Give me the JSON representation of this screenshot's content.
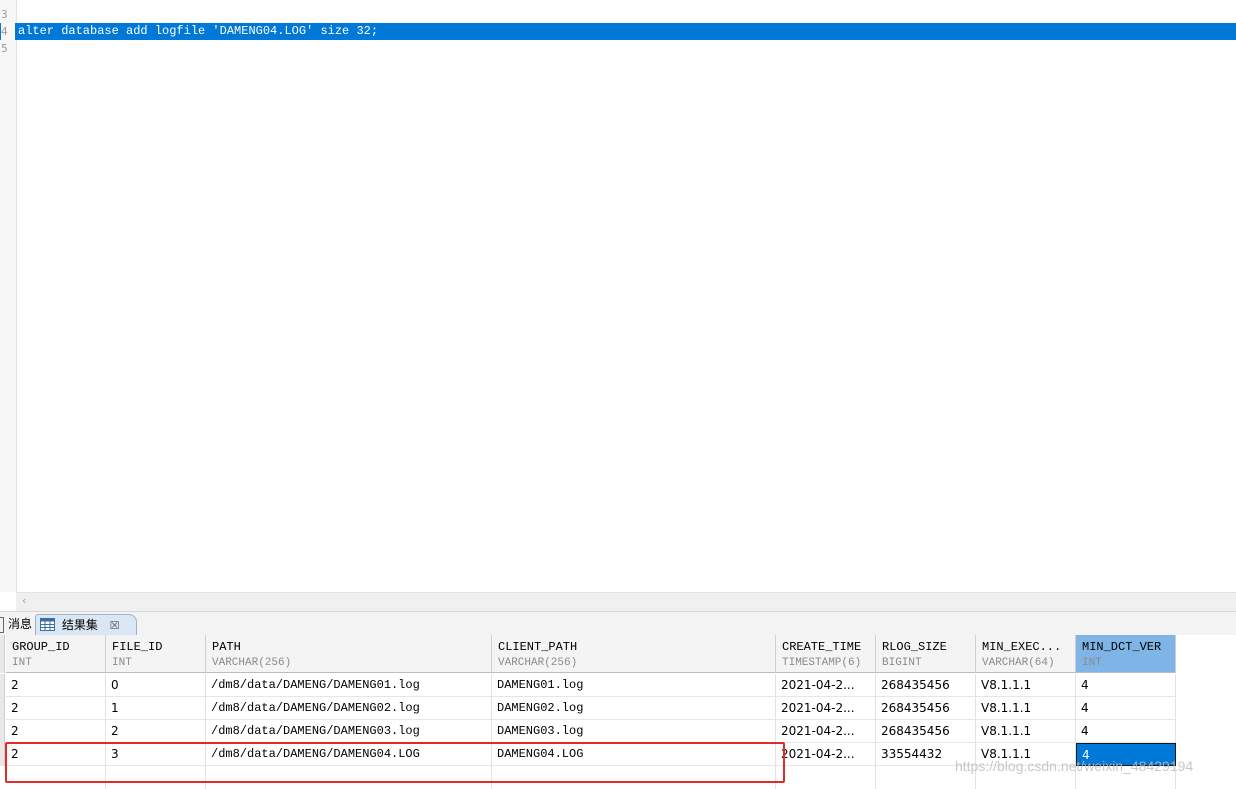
{
  "editor": {
    "lines": [
      {
        "num": "3",
        "text": ""
      },
      {
        "num": "4",
        "text": "alter database add logfile 'DAMENG04.LOG' size 32;"
      },
      {
        "num": "5",
        "text": ""
      }
    ]
  },
  "tabs": {
    "messages_label": "消息",
    "results_label": "结果集",
    "close_glyph": "☒"
  },
  "grid": {
    "columns": [
      {
        "name": "GROUP_ID",
        "type": "INT"
      },
      {
        "name": "FILE_ID",
        "type": "INT"
      },
      {
        "name": "PATH",
        "type": "VARCHAR(256)"
      },
      {
        "name": "CLIENT_PATH",
        "type": "VARCHAR(256)"
      },
      {
        "name": "CREATE_TIME",
        "type": "TIMESTAMP(6)"
      },
      {
        "name": "RLOG_SIZE",
        "type": "BIGINT"
      },
      {
        "name": "MIN_EXEC...",
        "type": "VARCHAR(64)"
      },
      {
        "name": "MIN_DCT_VER",
        "type": "INT"
      }
    ],
    "rows": [
      [
        "2",
        "0",
        "/dm8/data/DAMENG/DAMENG01.log",
        "DAMENG01.log",
        "2021-04-2...",
        "268435456",
        "V8.1.1.1",
        "4"
      ],
      [
        "2",
        "1",
        "/dm8/data/DAMENG/DAMENG02.log",
        "DAMENG02.log",
        "2021-04-2...",
        "268435456",
        "V8.1.1.1",
        "4"
      ],
      [
        "2",
        "2",
        "/dm8/data/DAMENG/DAMENG03.log",
        "DAMENG03.log",
        "2021-04-2...",
        "268435456",
        "V8.1.1.1",
        "4"
      ],
      [
        "2",
        "3",
        "/dm8/data/DAMENG/DAMENG04.LOG",
        "DAMENG04.LOG",
        "2021-04-2...",
        "33554432",
        "V8.1.1.1",
        "4"
      ]
    ]
  },
  "watermark": "https://blog.csdn.net/weixin_48429194",
  "colors": {
    "selection": "#0078d7",
    "active_header": "#7fb4e6",
    "annotation_box": "#e02b2b"
  }
}
